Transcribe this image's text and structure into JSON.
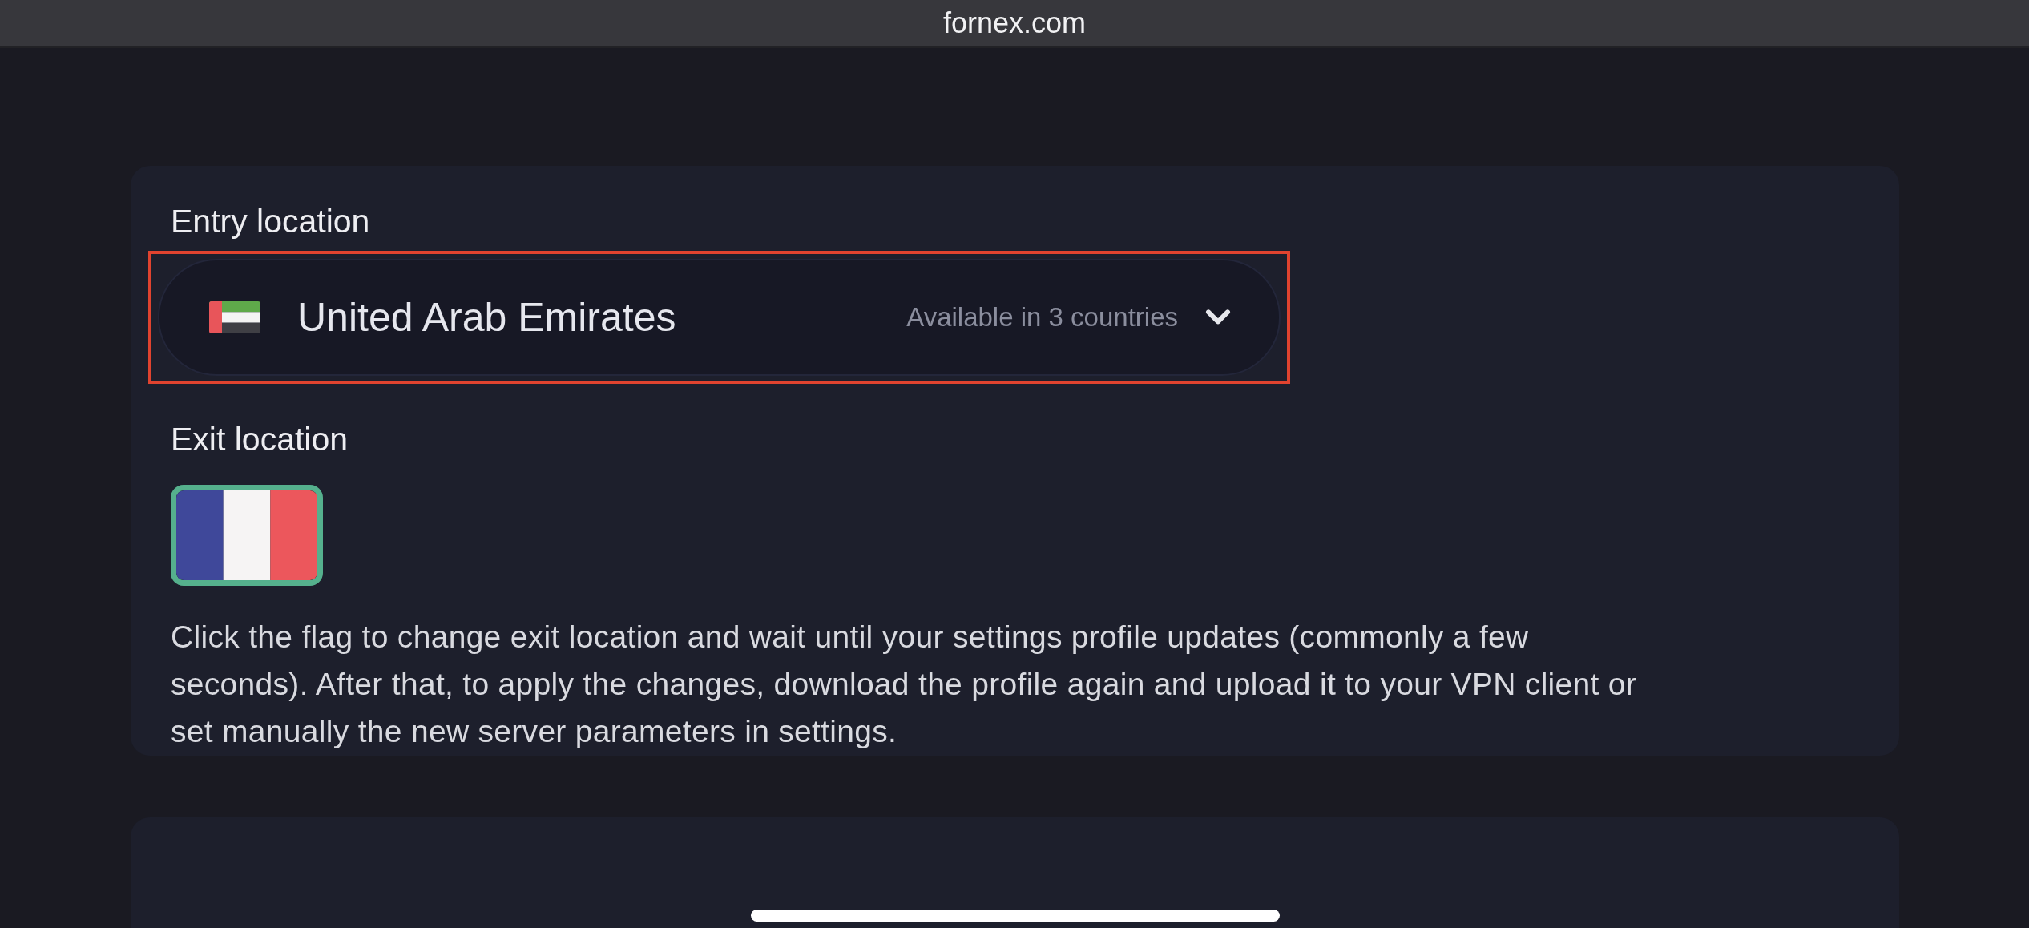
{
  "browser": {
    "url": "fornex.com"
  },
  "entry_location": {
    "label": "Entry location",
    "select": {
      "value": "United Arab Emirates",
      "hint": "Available in 3 countries",
      "highlighted": true
    }
  },
  "exit_location": {
    "label": "Exit location",
    "flags": [
      {
        "kind": "tricolor",
        "selected": true
      }
    ],
    "description": "Click the flag to change exit location and wait until your settings profile updates (commonly a few seconds). After that, to apply the changes, download the profile again and upload it to your VPN client or set manually the new server parameters in settings."
  }
}
